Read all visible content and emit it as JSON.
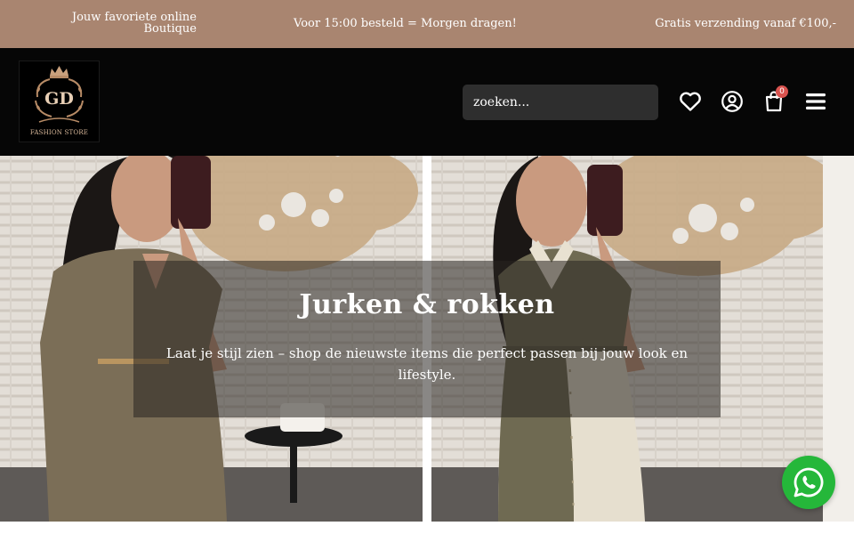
{
  "topbar": {
    "left_line1": "Jouw favoriete online",
    "left_line2": "Boutique",
    "center": "Voor 15:00 besteld = Morgen dragen!",
    "right": "Gratis verzending vanaf €100,-"
  },
  "header": {
    "logo_initials": "GD",
    "logo_text": "FASHION STORE",
    "search_placeholder": "zoeken...",
    "cart_count": "0",
    "icons": [
      "heart-icon",
      "user-icon",
      "cart-icon",
      "menu-icon"
    ]
  },
  "hero": {
    "title": "Jurken & rokken",
    "subtitle": "Laat je stijl zien – shop de nieuwste items die perfect passen bij jouw look en lifestyle."
  },
  "colors": {
    "topbar_bg": "#a98570",
    "header_bg": "#060606",
    "search_bg": "#2e2e2e",
    "badge": "#d9534f",
    "whatsapp": "#25b73a"
  }
}
